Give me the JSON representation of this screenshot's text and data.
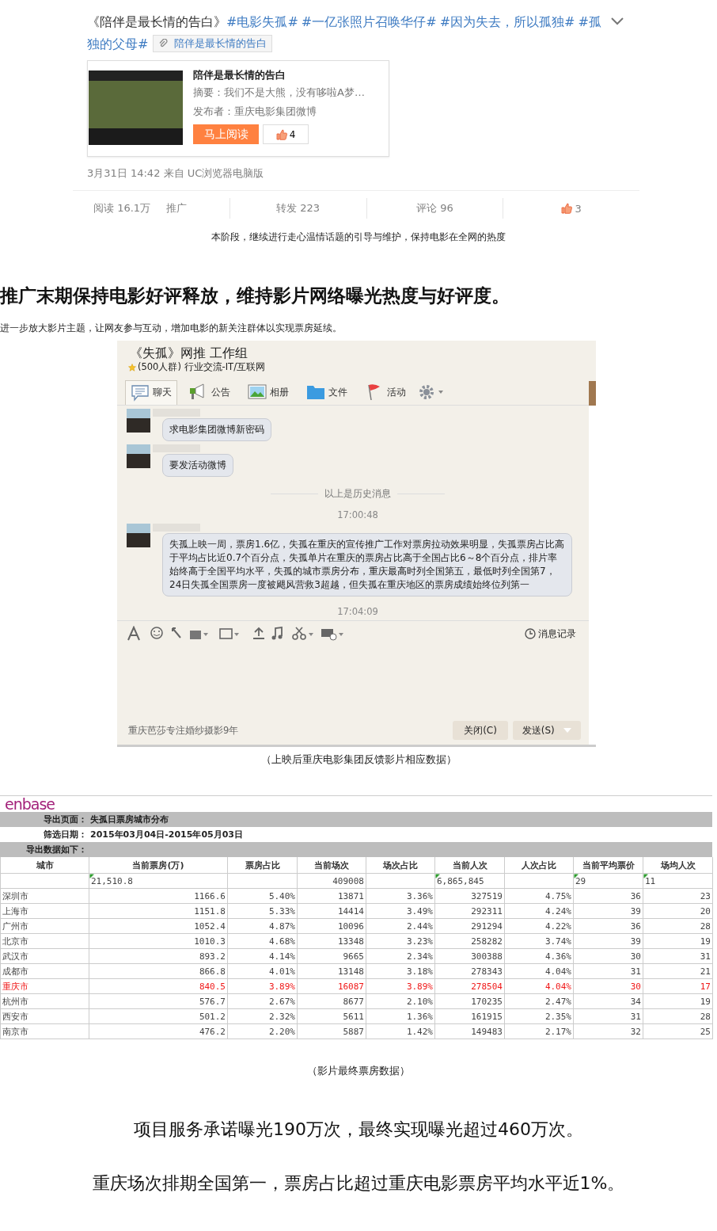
{
  "weibo_post": {
    "segments": [
      {
        "kind": "plain",
        "text": "《陪伴是最长情的告白》"
      },
      {
        "kind": "topic",
        "text": "#电影失孤#"
      },
      {
        "kind": "topic",
        "text": "#一亿张照片召唤华仔#"
      },
      {
        "kind": "topic",
        "text": "#因为失去，所以孤独#"
      },
      {
        "kind": "topic",
        "text": "#孤独的父母#"
      }
    ],
    "link_chip": "陪伴是最长情的告白",
    "card": {
      "title": "陪伴是最长情的告白",
      "summary": "摘要：我们不是大熊，没有哆啦A梦…",
      "publisher": "发布者：重庆电影集团微博",
      "read_button": "马上阅读",
      "like_count": "4"
    },
    "meta": "3月31日 14:42 来自 UC浏览器电脑版",
    "reads": "阅读 16.1万",
    "promote": "推广",
    "forward": "转发 223",
    "comment": "评论 96",
    "likes": "3"
  },
  "caption_1": "本阶段，继续进行走心温情话题的引导与维护，保持电影在全网的热度",
  "heading": "推广末期保持电影好评释放，维持影片网络曝光热度与好评度。",
  "intro": "进一步放大影片主题，让网友参与互动，增加电影的新关注群体以实现票房延续。",
  "chat_window": {
    "title": "《失孤》网推 工作组",
    "subtitle": "(500人群) 行业交流-IT/互联网",
    "tabs": [
      {
        "label": "聊天",
        "selected": true
      },
      {
        "label": "公告",
        "selected": false
      },
      {
        "label": "相册",
        "selected": false
      },
      {
        "label": "文件",
        "selected": false
      },
      {
        "label": "活动",
        "selected": false
      }
    ],
    "items": [
      {
        "kind": "message",
        "text": "求电影集团微博新密码"
      },
      {
        "kind": "message",
        "text": "要发活动微博"
      },
      {
        "kind": "divider",
        "text": "以上是历史消息"
      },
      {
        "kind": "time",
        "text": "17:00:48"
      },
      {
        "kind": "message",
        "text": "失孤上映一周，票房1.6亿，失孤在重庆的宣传推广工作对票房拉动效果明显，失孤票房占比高于平均占比近0.7个百分点，失孤单片在重庆的票房占比高于全国占比6～8个百分点，排片率始终高于全国平均水平，失孤的城市票房分布，重庆最高时列全国第五，最低时列全国第7，24日失孤全国票房一度被飓风营救3超越，但失孤在重庆地区的票房成绩始终位列第一"
      },
      {
        "kind": "time",
        "text": "17:04:09"
      }
    ],
    "history_button": "消息记录",
    "footer_text": "重庆芭莎专注婚纱摄影9年",
    "close_button": "关闭(C)",
    "send_button": "发送(S)"
  },
  "caption_2": "（上映后重庆电影集团反馈影片相应数据）",
  "table": {
    "logo": "enbase",
    "export_label": "导出页面：",
    "export_value": "失孤日票房城市分布",
    "date_label": "筛选日期：",
    "date_value": "2015年03月04日-2015年05月03日",
    "data_label": "导出数据如下：",
    "columns": [
      "城市",
      "当前票房(万)",
      "票房占比",
      "当前场次",
      "场次占比",
      "当前人次",
      "人次占比",
      "当前平均票价",
      "场均人次"
    ],
    "total_row": [
      {
        "kind": "empty"
      },
      {
        "kind": "text",
        "text": "21,510.8"
      },
      {
        "kind": "empty"
      },
      {
        "kind": "number",
        "text": "409008"
      },
      {
        "kind": "empty"
      },
      {
        "kind": "text",
        "text": "6,865,845"
      },
      {
        "kind": "empty"
      },
      {
        "kind": "text",
        "text": "29"
      },
      {
        "kind": "text",
        "text": "11"
      }
    ],
    "rows": [
      {
        "highlighted": false,
        "cells": [
          "深圳市",
          "1166.6",
          "5.40%",
          "13871",
          "3.36%",
          "327519",
          "4.75%",
          "36",
          "23"
        ]
      },
      {
        "highlighted": false,
        "cells": [
          "上海市",
          "1151.8",
          "5.33%",
          "14414",
          "3.49%",
          "292311",
          "4.24%",
          "39",
          "20"
        ]
      },
      {
        "highlighted": false,
        "cells": [
          "广州市",
          "1052.4",
          "4.87%",
          "10096",
          "2.44%",
          "291294",
          "4.22%",
          "36",
          "28"
        ]
      },
      {
        "highlighted": false,
        "cells": [
          "北京市",
          "1010.3",
          "4.68%",
          "13348",
          "3.23%",
          "258282",
          "3.74%",
          "39",
          "19"
        ]
      },
      {
        "highlighted": false,
        "cells": [
          "武汉市",
          "893.2",
          "4.14%",
          "9665",
          "2.34%",
          "300388",
          "4.36%",
          "30",
          "31"
        ]
      },
      {
        "highlighted": false,
        "cells": [
          "成都市",
          "866.8",
          "4.01%",
          "13148",
          "3.18%",
          "278343",
          "4.04%",
          "31",
          "21"
        ]
      },
      {
        "highlighted": true,
        "cells": [
          "重庆市",
          "840.5",
          "3.89%",
          "16087",
          "3.89%",
          "278504",
          "4.04%",
          "30",
          "17"
        ]
      },
      {
        "highlighted": false,
        "cells": [
          "杭州市",
          "576.7",
          "2.67%",
          "8677",
          "2.10%",
          "170235",
          "2.47%",
          "34",
          "19"
        ]
      },
      {
        "highlighted": false,
        "cells": [
          "西安市",
          "501.2",
          "2.32%",
          "5611",
          "1.36%",
          "161915",
          "2.35%",
          "31",
          "28"
        ]
      },
      {
        "highlighted": false,
        "cells": [
          "南京市",
          "476.2",
          "2.20%",
          "5887",
          "1.42%",
          "149483",
          "2.17%",
          "32",
          "25"
        ]
      }
    ]
  },
  "caption_3": "（影片最终票房数据）",
  "closing": [
    "项目服务承诺曝光190万次，最终实现曝光超过460万次。",
    "重庆场次排期全国第一，票房占比超过重庆电影票房平均水平近1%。"
  ]
}
